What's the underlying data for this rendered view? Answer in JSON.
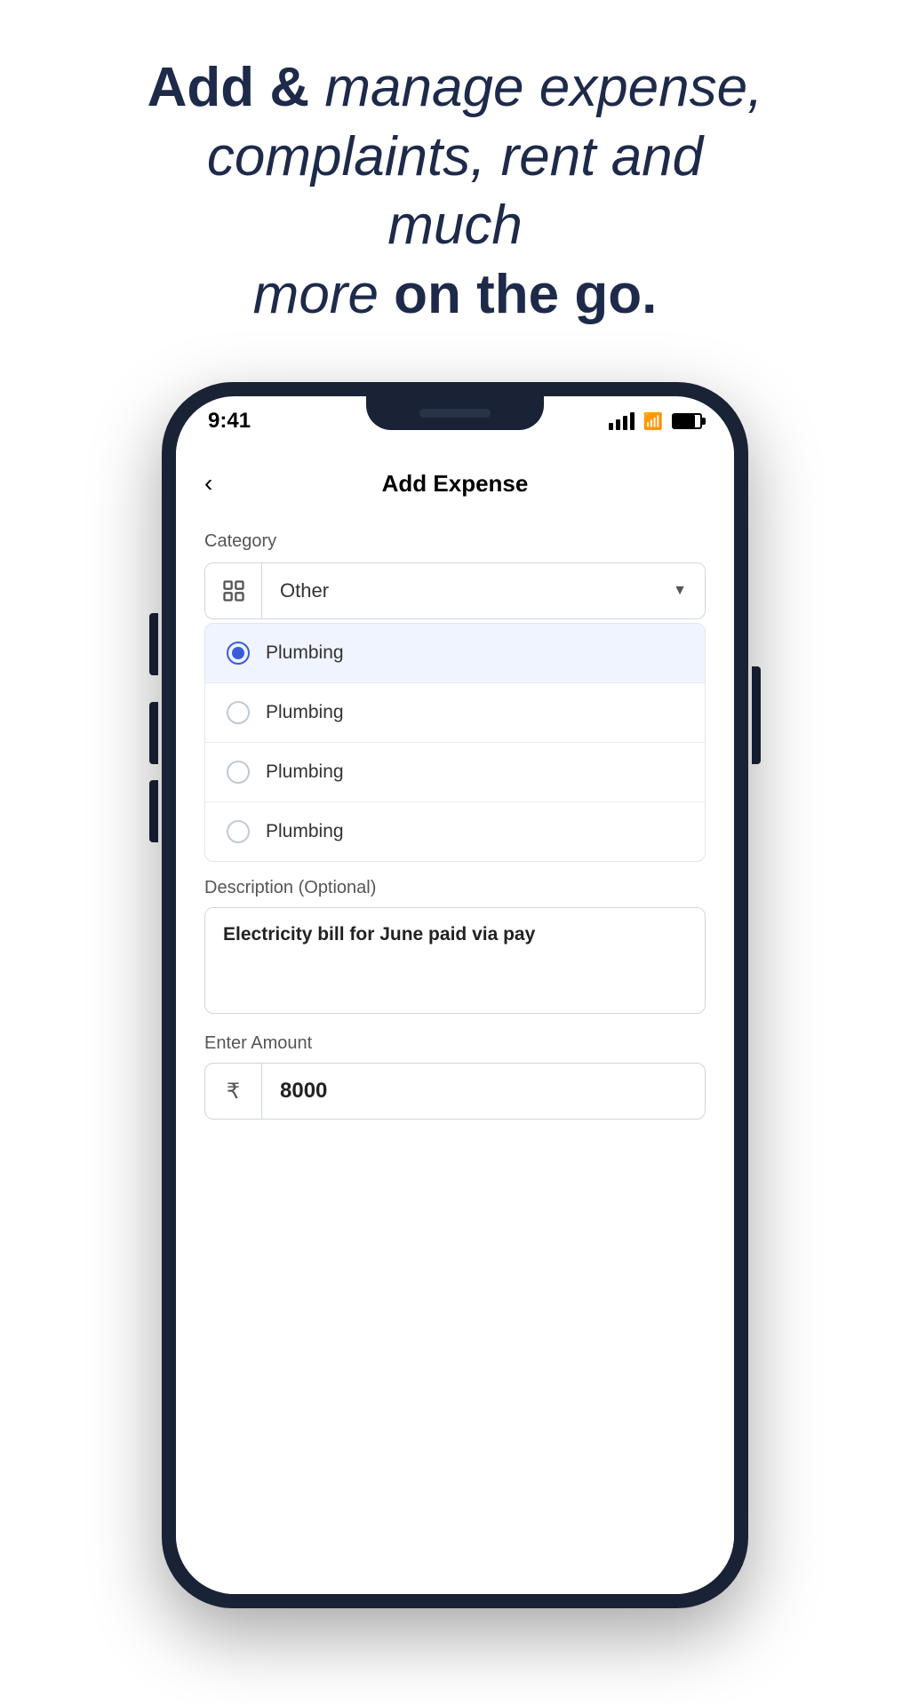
{
  "hero": {
    "line1_bold": "Add &",
    "line1_italic": " manage expense,",
    "line2": "complaints, rent and much",
    "line3_italic": "more",
    "line3_bold": " on the go."
  },
  "status_bar": {
    "time": "9:41",
    "signal_icon": "signal-icon",
    "wifi_icon": "wifi-icon",
    "battery_icon": "battery-icon"
  },
  "header": {
    "back_label": "‹",
    "title": "Add Expense"
  },
  "form": {
    "category_label": "Category",
    "category_selected": "Other",
    "category_icon": "grid-icon",
    "dropdown_arrow": "▼",
    "radio_options": [
      {
        "label": "Plumbing",
        "selected": true
      },
      {
        "label": "Plumbing",
        "selected": false
      },
      {
        "label": "Plumbing",
        "selected": false
      },
      {
        "label": "Plumbing",
        "selected": false
      }
    ],
    "description_label": "Description (Optional)",
    "description_value": "Electricity bill for June paid via pay",
    "amount_label": "Enter Amount",
    "currency_symbol": "₹",
    "amount_value": "8000"
  }
}
